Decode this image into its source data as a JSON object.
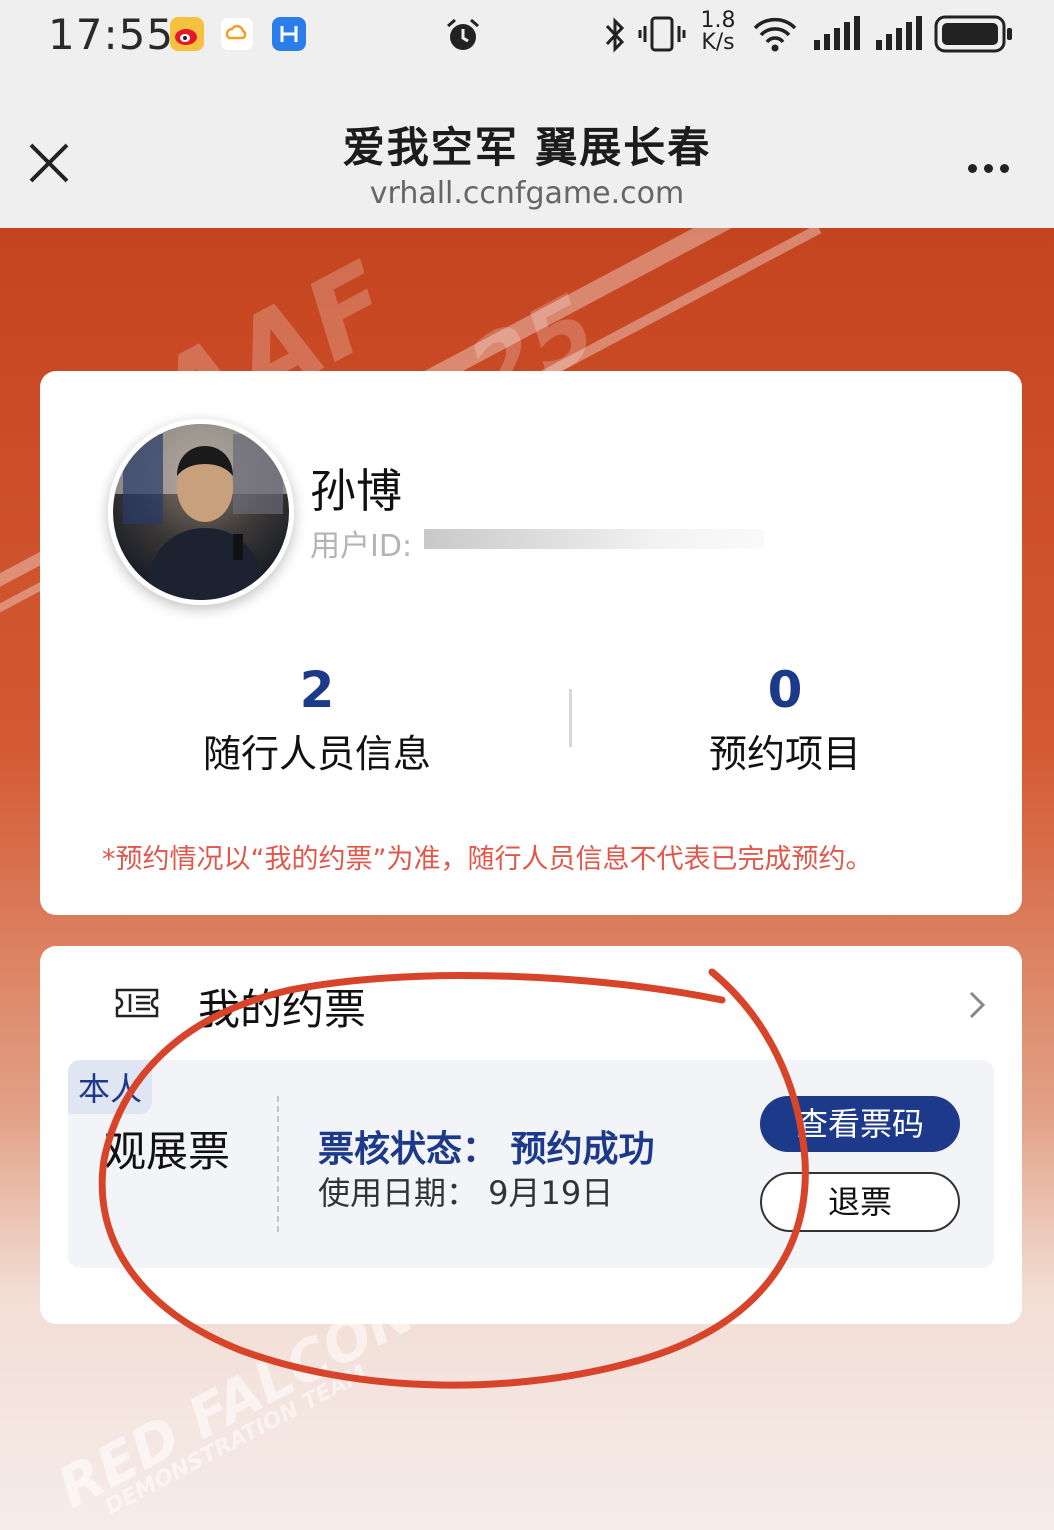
{
  "status_bar": {
    "time": "17:55",
    "net_speed_top": "1.8",
    "net_speed_bottom": "K/s",
    "icons": [
      "weibo-icon",
      "cloud-app-icon",
      "blue-app-icon",
      "alarm-icon",
      "bluetooth-icon",
      "vibrate-icon",
      "wifi-icon",
      "signal-icon",
      "signal-icon",
      "battery-icon"
    ]
  },
  "title_bar": {
    "title": "爱我空军 翼展长春",
    "url": "vrhall.ccnfgame.com"
  },
  "background": {
    "texts": [
      "AAF",
      "25",
      "RED FALCON",
      "DEMONSTRATION TEAM"
    ]
  },
  "profile": {
    "name": "孙博",
    "user_id_label": "用户ID:",
    "stats": [
      {
        "value": "2",
        "label": "随行人员信息"
      },
      {
        "value": "0",
        "label": "预约项目"
      }
    ],
    "note": "*预约情况以“我的约票”为准，随行人员信息不代表已完成预约。"
  },
  "my_tickets": {
    "title": "我的约票",
    "ticket": {
      "owner_tag": "本人",
      "type": "观展票",
      "status": "票核状态：  预约成功",
      "date": "使用日期：  9月19日",
      "view_code_button": "查看票码",
      "refund_button": "退票"
    }
  },
  "colors": {
    "accent": "#1d3a8a",
    "note_red": "#e0584a",
    "annotation_red": "#d8442a"
  }
}
